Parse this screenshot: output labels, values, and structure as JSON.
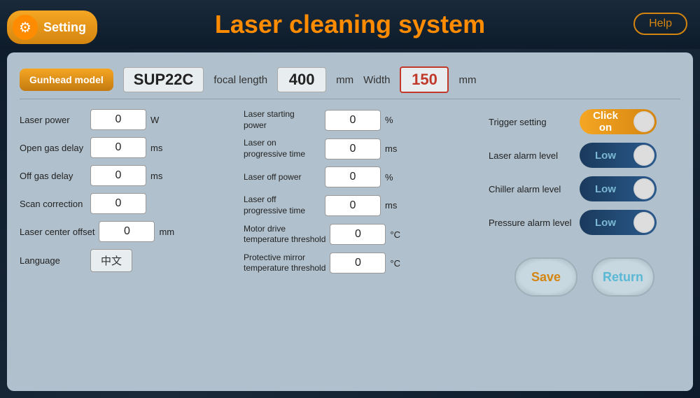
{
  "title": "Laser cleaning system",
  "header": {
    "setting_label": "Setting",
    "help_label": "Help"
  },
  "top_row": {
    "gunhead_label": "Gunhead model",
    "model_value": "SUP22C",
    "focal_label": "focal length",
    "focal_value": "400",
    "focal_unit": "mm",
    "width_label": "Width",
    "width_value": "150",
    "width_unit": "mm"
  },
  "left_fields": [
    {
      "label": "Laser power",
      "value": "0",
      "unit": "W"
    },
    {
      "label": "Open gas delay",
      "value": "0",
      "unit": "ms"
    },
    {
      "label": "Off gas delay",
      "value": "0",
      "unit": "ms"
    },
    {
      "label": "Scan correction",
      "value": "0",
      "unit": ""
    },
    {
      "label": "Laser center offset",
      "value": "0",
      "unit": "mm"
    },
    {
      "label": "Language",
      "value": "中文",
      "unit": ""
    }
  ],
  "middle_fields": [
    {
      "label": "Laser starting power",
      "value": "0",
      "unit": "%"
    },
    {
      "label": "Laser on progressive time",
      "value": "0",
      "unit": "ms"
    },
    {
      "label": "Laser off power",
      "value": "0",
      "unit": "%"
    },
    {
      "label": "Laser off progressive time",
      "value": "0",
      "unit": "ms"
    },
    {
      "label": "Motor drive temperature threshold",
      "value": "0",
      "unit": "°C"
    },
    {
      "label": "Protective mirror temperature threshold",
      "value": "0",
      "unit": "°C"
    }
  ],
  "right_section": {
    "trigger_label": "Trigger setting",
    "trigger_toggle": "Click on",
    "alarm_items": [
      {
        "label": "Laser alarm level",
        "value": "Low"
      },
      {
        "label": "Chiller alarm level",
        "value": "Low"
      },
      {
        "label": "Pressure alarm level",
        "value": "Low"
      }
    ]
  },
  "actions": {
    "save_label": "Save",
    "return_label": "Return"
  }
}
